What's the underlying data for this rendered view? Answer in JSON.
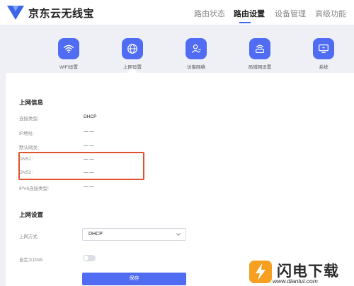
{
  "header": {
    "brand": "京东云无线宝",
    "nav": [
      {
        "label": "路由状态",
        "active": false
      },
      {
        "label": "路由设置",
        "active": true
      },
      {
        "label": "设备管理",
        "active": false
      },
      {
        "label": "高级功能",
        "active": false
      }
    ]
  },
  "iconbar": {
    "items": [
      {
        "label": "WiFi设置",
        "icon": "wifi-icon",
        "active": false
      },
      {
        "label": "上网设置",
        "icon": "globe-icon",
        "active": true
      },
      {
        "label": "访客网络",
        "icon": "guest-user-icon",
        "active": false
      },
      {
        "label": "局域网设置",
        "icon": "router-icon",
        "active": false
      },
      {
        "label": "系统",
        "icon": "system-monitor-icon",
        "active": false
      }
    ]
  },
  "internet_info": {
    "title": "上网信息",
    "rows": [
      {
        "label": "连接类型:",
        "value": "DHCP"
      },
      {
        "label": "IP地址:",
        "value": "— —"
      },
      {
        "label": "默认网关:",
        "value": "— —"
      },
      {
        "label": "DNS1:",
        "value": "— —"
      },
      {
        "label": "DNS2:",
        "value": "— —"
      },
      {
        "label": "IPV6连接类型:",
        "value": "— —"
      }
    ]
  },
  "internet_settings": {
    "title": "上网设置",
    "mode_label": "上网方式",
    "mode_value": "DHCP",
    "custom_dns_label": "自定义DNS",
    "custom_dns_enabled": false,
    "save_label": "保存"
  },
  "watermark": {
    "title": "闪电下载",
    "url": "www.dianlut.com"
  },
  "colors": {
    "accent": "#4f6cf2",
    "highlight_box": "#e1532e",
    "background": "#eef0f6"
  }
}
